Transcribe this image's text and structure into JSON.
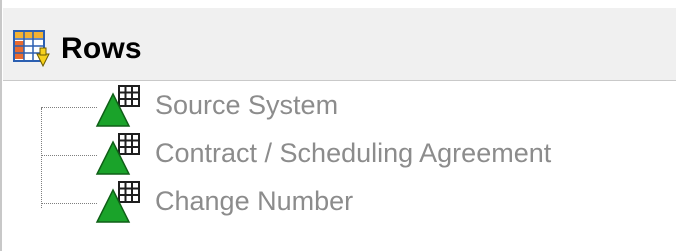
{
  "panel": {
    "title": "Rows",
    "header_icon": "rows-table-icon",
    "items": [
      {
        "label": "Source System",
        "icon": "dimension-icon"
      },
      {
        "label": "Contract / Scheduling Agreement",
        "icon": "dimension-icon"
      },
      {
        "label": "Change Number",
        "icon": "dimension-icon"
      }
    ]
  },
  "colors": {
    "item_text": "#8c8c8c",
    "triangle_green": "#1aa32a",
    "grid_dark": "#1f1f1f"
  }
}
